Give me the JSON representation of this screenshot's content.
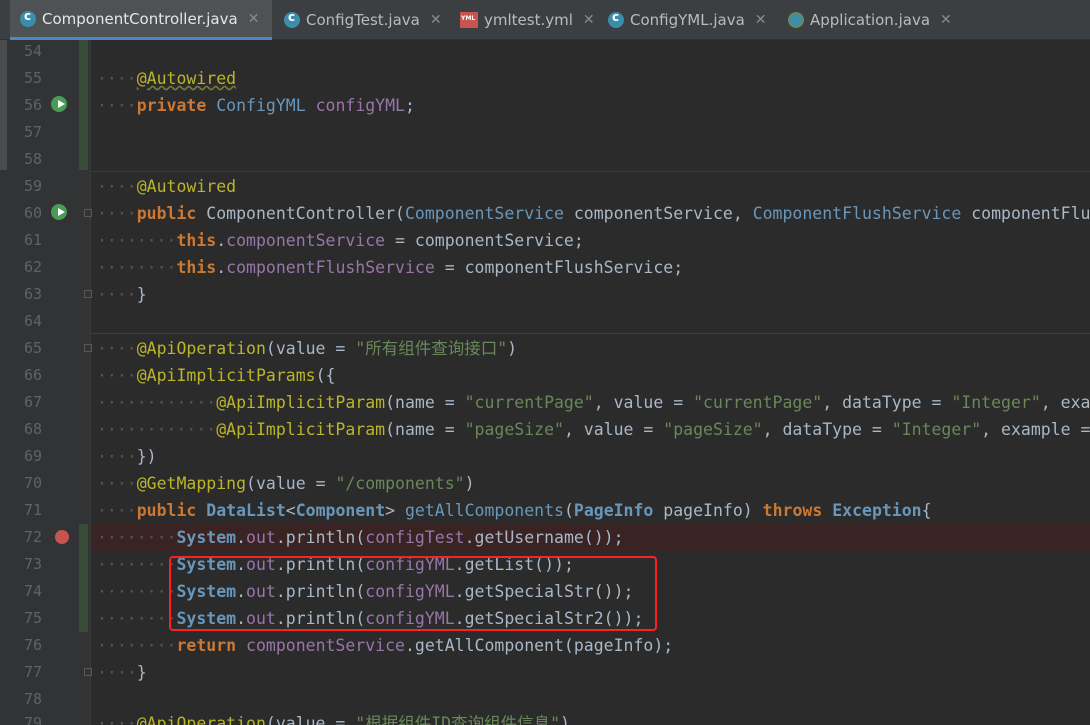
{
  "tabs": [
    {
      "label": "ComponentController.java",
      "icon": "java-class-icon",
      "active": true
    },
    {
      "label": "ConfigTest.java",
      "icon": "java-class-icon",
      "active": false
    },
    {
      "label": "ymltest.yml",
      "icon": "yml-file-icon",
      "active": false
    },
    {
      "label": "ConfigYML.java",
      "icon": "java-class-icon",
      "active": false
    },
    {
      "label": "Application.java",
      "icon": "spring-app-icon",
      "active": false
    }
  ],
  "close_glyph": "✕",
  "line_numbers": [
    "54",
    "55",
    "56",
    "57",
    "58",
    "59",
    "60",
    "61",
    "62",
    "63",
    "64",
    "65",
    "66",
    "67",
    "68",
    "69",
    "70",
    "71",
    "72",
    "73",
    "74",
    "75",
    "76",
    "77",
    "78",
    "79"
  ],
  "code": {
    "l55": {
      "ann": "@Autowired"
    },
    "l56": {
      "kw": "private",
      "type": "ConfigYML",
      "name": "configYML",
      "end": ";"
    },
    "l59": {
      "ann": "@Autowired"
    },
    "l60": {
      "kw": "public",
      "name": "ComponentController(",
      "t1": "ComponentService",
      "p1": " componentService, ",
      "t2": "ComponentFlushService",
      "p2": " componentFlushService){"
    },
    "l61": {
      "kw": "this",
      "dot": ".",
      "field": "componentService",
      "rest": " = componentService;"
    },
    "l62": {
      "kw": "this",
      "dot": ".",
      "field": "componentFlushService",
      "rest": " = componentFlushService;"
    },
    "l63": {
      "text": "}"
    },
    "l65": {
      "ann": "@ApiOperation",
      "a": "(value = ",
      "str": "\"所有组件查询接口\"",
      "b": ")"
    },
    "l66": {
      "ann": "@ApiImplicitParams",
      "a": "({"
    },
    "l67": {
      "ann": "@ApiImplicitParam",
      "a": "(name = ",
      "s1": "\"currentPage\"",
      "b": ", value = ",
      "s2": "\"currentPage\"",
      "c": ", dataType = ",
      "s3": "\"Integer\"",
      "d": ", example = "
    },
    "l68": {
      "ann": "@ApiImplicitParam",
      "a": "(name = ",
      "s1": "\"pageSize\"",
      "b": ", value = ",
      "s2": "\"pageSize\"",
      "c": ", dataType = ",
      "s3": "\"Integer\"",
      "d": ", example = "
    },
    "l69": {
      "text": "})"
    },
    "l70": {
      "ann": "@GetMapping",
      "a": "(value = ",
      "str": "\"/components\"",
      "b": ")"
    },
    "l71": {
      "kw": "public",
      "t1": "DataList",
      "lt": "<",
      "t2": "Component",
      "gt": ">",
      "meth": "getAllComponents",
      "a": "(",
      "t3": "PageInfo",
      "b": " pageInfo) ",
      "kw2": "throws",
      "t4": "Exception",
      "c": "{"
    },
    "l72": {
      "cls": "System",
      "d1": ".",
      "f": "out",
      "d2": ".",
      "m": "println(",
      "v": "configTest",
      "rest": ".getUsername());"
    },
    "l73": {
      "cls": "System",
      "d1": ".",
      "f": "out",
      "d2": ".",
      "m": "println(",
      "v": "configYML",
      "rest": ".getList());"
    },
    "l74": {
      "cls": "System",
      "d1": ".",
      "f": "out",
      "d2": ".",
      "m": "println(",
      "v": "configYML",
      "rest": ".getSpecialStr());"
    },
    "l75": {
      "cls": "System",
      "d1": ".",
      "f": "out",
      "d2": ".",
      "m": "println(",
      "v": "configYML",
      "rest": ".getSpecialStr2());"
    },
    "l76": {
      "kw": "return",
      "v": "componentService",
      "rest": ".getAllComponent(pageInfo);"
    },
    "l77": {
      "text": "}"
    },
    "l79": {
      "ann": "@ApiOperation",
      "a": "(value = ",
      "str": "\"根据组件ID查询组件信息\"",
      "b": ")"
    }
  },
  "colors": {
    "annotation": "#bbb529",
    "keyword": "#cc7832",
    "string": "#6a8759",
    "field": "#9876aa",
    "highlight_box": "#ff2020",
    "breakpoint": "#c75450"
  }
}
